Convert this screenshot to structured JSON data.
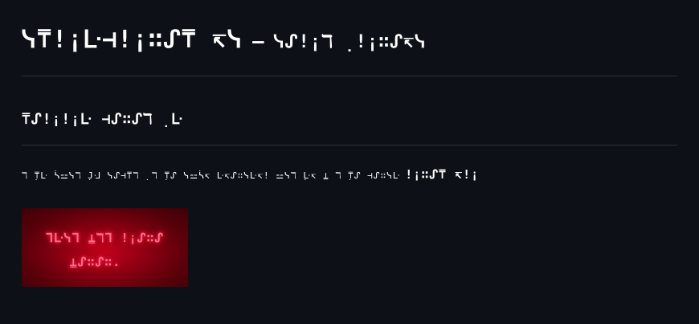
{
  "header": {
    "title": "ᓭ⍑!¡ᒷ⊣!¡∷ᔑ⍑ ↸ᓭ",
    "separator": "–",
    "subtitle": "ᓭᔑ!¡ℸ ̣!¡∷ᔑ↸ᓭ"
  },
  "section": {
    "heading": "⍑ᔑ!¡!¡ᒷ ⊣ᔑ∷ᔑℸ ̣ᒷ"
  },
  "body": {
    "text": "ℸ ̣⍑ᒷ ᓵ⚍ᓭℸ ̣𝙹ᒲ ᓭᔑ⊣⍑ℸ ̣ ℸ ̣⍑ᔑ ᓭ⚍ᓵ↸ ᒷ↸ᔑ∷ᓭᒷ↸! ⚍ᓭℸ ̣ᒷ↸ ⍊ ℸ ̣⍑ᔑ ⊣ᔑ∷ᓭᒷ",
    "code": "!¡∷ᔑ⍑ ↸!¡"
  },
  "image": {
    "line1": "ᒣᒷᓭᒣ ⍊ℸᒣ !¡ᔑ∷ᔑ",
    "line2": "⍊ᔑ∷ᔑ∷."
  }
}
